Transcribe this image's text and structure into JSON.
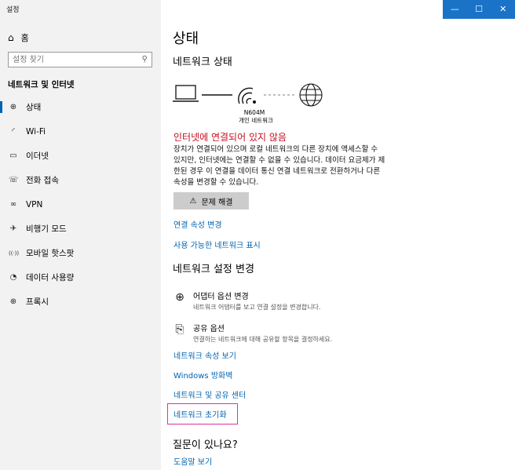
{
  "window": {
    "title": "설정",
    "buttons": {
      "minimize": "—",
      "maximize": "☐",
      "close": "✕"
    }
  },
  "sidebar": {
    "home_label": "홈",
    "search_placeholder": "설정 찾기",
    "section_title": "네트워크 및 인터넷",
    "items": [
      {
        "label": "상태",
        "icon": "status-icon",
        "glyph": "⊕"
      },
      {
        "label": "Wi-Fi",
        "icon": "wifi-icon",
        "glyph": "◜"
      },
      {
        "label": "이더넷",
        "icon": "ethernet-icon",
        "glyph": "▭"
      },
      {
        "label": "전화 접속",
        "icon": "dialup-icon",
        "glyph": "☏"
      },
      {
        "label": "VPN",
        "icon": "vpn-icon",
        "glyph": "∞"
      },
      {
        "label": "비행기 모드",
        "icon": "airplane-icon",
        "glyph": "✈"
      },
      {
        "label": "모바일 핫스팟",
        "icon": "hotspot-icon",
        "glyph": "((·))"
      },
      {
        "label": "데이터 사용량",
        "icon": "data-usage-icon",
        "glyph": "◔"
      },
      {
        "label": "프록시",
        "icon": "proxy-icon",
        "glyph": "⊕"
      }
    ]
  },
  "main": {
    "title": "상태",
    "network_status_heading": "네트워크 상태",
    "network": {
      "name": "N604M",
      "type": "개인 네트워크"
    },
    "error_title": "인터넷에 연결되어 있지 않음",
    "error_desc": "장치가 연결되어 있으며 로컬 네트워크의 다른 장치에 액세스할 수 있지만, 인터넷에는 연결할 수 없을 수 있습니다. 데이터 요금제가 제한된 경우 이 연결을 데이터 통신 연결 네트워크로 전환하거나 다른 속성을 변경할 수 있습니다.",
    "troubleshoot_label": "문제 해결",
    "link_connection_props": "연결 속성 변경",
    "link_available_networks": "사용 가능한 네트워크 표시",
    "change_settings_heading": "네트워크 설정 변경",
    "adapter": {
      "title": "어댑터 옵션 변경",
      "desc": "네트워크 어댑터를 보고 연결 설정을 변경합니다."
    },
    "sharing": {
      "title": "공유 옵션",
      "desc": "연결하는 네트워크에 대해 공유할 항목을 결정하세요."
    },
    "link_network_props": "네트워크 속성 보기",
    "link_firewall": "Windows 방화벽",
    "link_sharing_center": "네트워크 및 공유 센터",
    "link_reset": "네트워크 초기화",
    "question_heading": "질문이 있나요?",
    "link_help": "도움말 보기"
  }
}
